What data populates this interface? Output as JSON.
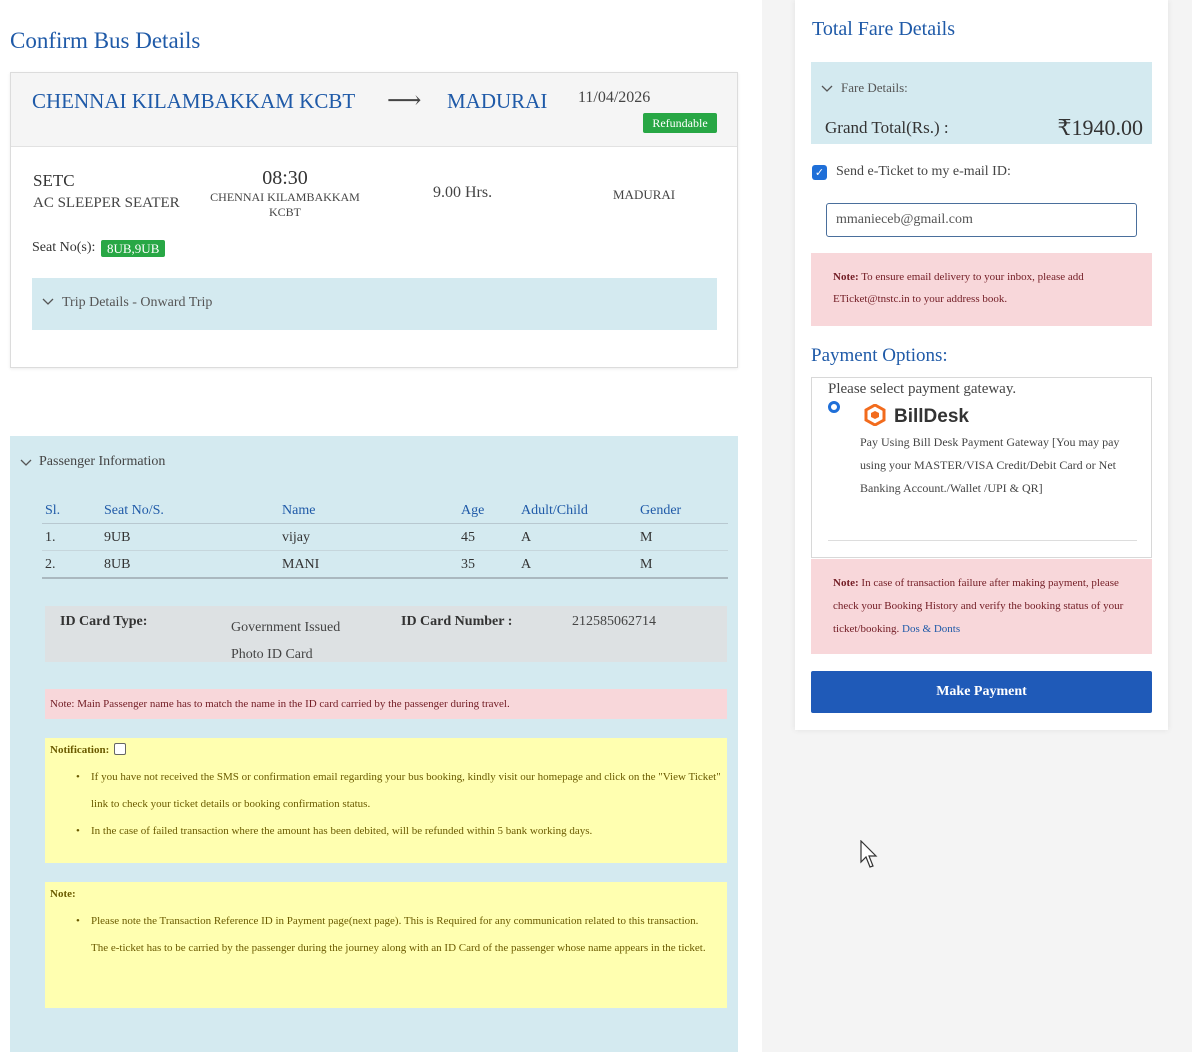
{
  "page_title": "Confirm Bus Details",
  "route": {
    "from": "CHENNAI KILAMBAKKAM KCBT",
    "arrow": "⟶",
    "to": "MADURAI",
    "date": "11/04/2026",
    "badge": "Refundable"
  },
  "bus": {
    "operator": "SETC",
    "type": "AC SLEEPER SEATER",
    "departure_time": "08:30",
    "departure_stop": "CHENNAI KILAMBAKKAM KCBT",
    "duration": "9.00 Hrs.",
    "arrival_stop": "MADURAI",
    "seat_label": "Seat No(s):",
    "seats": "8UB,9UB"
  },
  "trip_accordion": "Trip Details - Onward Trip",
  "passenger": {
    "accordion": "Passenger Information",
    "headers": [
      "Sl.",
      "Seat No/S.",
      "Name",
      "Age",
      "Adult/Child",
      "Gender"
    ],
    "rows": [
      [
        "1.",
        "9UB",
        "vijay",
        "45",
        "A",
        "M"
      ],
      [
        "2.",
        "8UB",
        "MANI",
        "35",
        "A",
        "M"
      ]
    ],
    "id_type_label": "ID Card Type:",
    "id_type_value": "Government Issued Photo ID Card",
    "id_number_label": "ID Card Number :",
    "id_number_value": "212585062714",
    "name_note": "Note: Main Passenger name has to match the name in the ID card carried by the passenger during travel."
  },
  "notification": {
    "title": "Notification:",
    "items": [
      "If you have not received the SMS or confirmation email regarding your bus booking, kindly visit our homepage and click on the \"View Ticket\" link to check your ticket details or booking confirmation status.",
      "In the case of failed transaction where the amount has been debited, will be refunded within 5 bank working days."
    ]
  },
  "note": {
    "title": "Note:",
    "items": [
      "Please note the Transaction Reference ID in Payment page(next page). This is Required for any communication related to this transaction. The e-ticket has to be carried by the passenger during the journey along with an ID Card of the passenger whose name appears in the ticket."
    ]
  },
  "fare": {
    "title": "Total Fare Details",
    "accordion": "Fare Details:",
    "grand_total_label": "Grand Total(Rs.) :",
    "grand_total_value": "₹1940.00"
  },
  "email": {
    "checkbox_label": "Send e-Ticket to my e-mail ID:",
    "value": "mmanieceb@gmail.com",
    "note_bold": "Note:",
    "note_text": "To ensure email delivery to your inbox, please add ETicket@tnstc.in to your address book."
  },
  "payment": {
    "title": "Payment Options:",
    "prompt": "Please select payment gateway.",
    "gateway_name": "BillDesk",
    "gateway_desc": "Pay Using Bill Desk Payment Gateway [You may pay using your MASTER/VISA Credit/Debit Card or Net Banking Account./Wallet /UPI & QR]",
    "fail_note_bold": "Note:",
    "fail_note_text": "In case of transaction failure after making payment, please check your Booking History and verify the booking status of your ticket/booking.",
    "fail_link": "Dos & Donts",
    "button": "Make Payment"
  },
  "colors": {
    "primary": "#1f5aa8",
    "accent_blue": "#d4eaf0",
    "success": "#28a745",
    "danger_bg": "#f8d7da",
    "warning_bg": "#ffffb0"
  }
}
